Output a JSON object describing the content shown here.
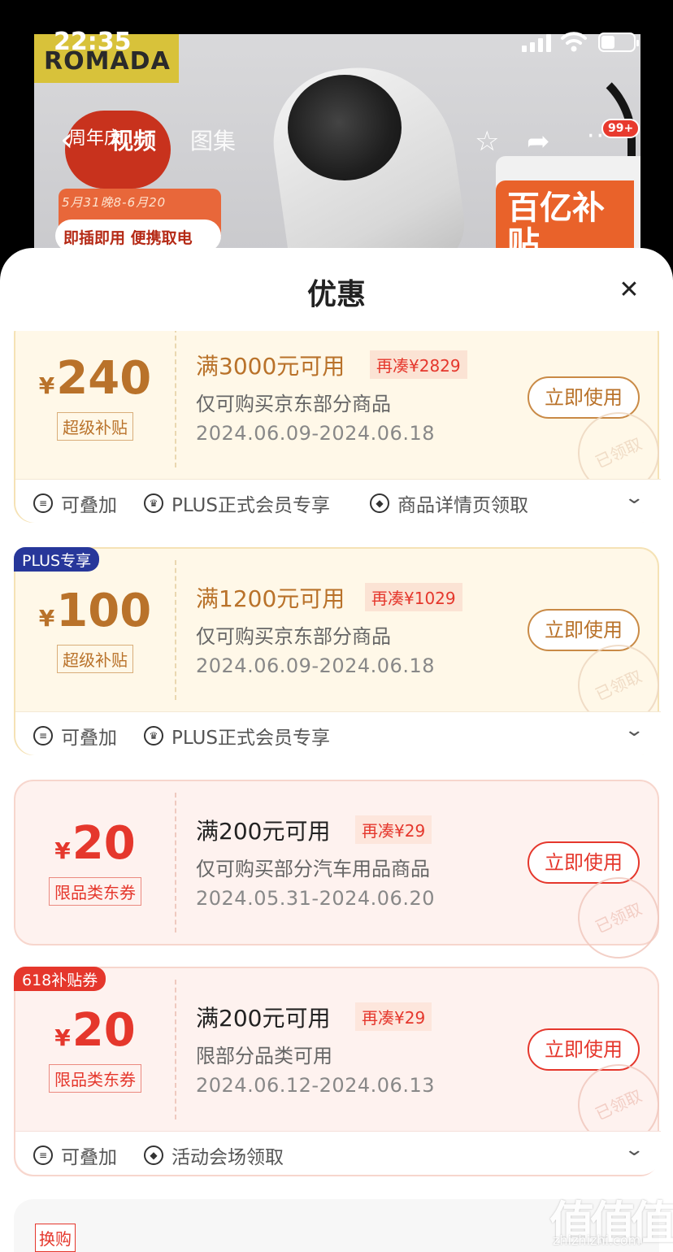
{
  "status_bar": {
    "time": "22:35"
  },
  "hero": {
    "brand": "ROMADA",
    "anniversary": "周年庆",
    "promo_dates": "5月31晚8-6月20",
    "promo_slogan": "即插即用 便携取电",
    "subsidy_badge": "百亿补贴",
    "tabs": [
      "视频",
      "图集"
    ],
    "cart_badge": "99+"
  },
  "sheet": {
    "title": "优惠"
  },
  "coupons": [
    {
      "corner_badge": "",
      "currency": "¥",
      "amount": "240",
      "tag": "超级补贴",
      "condition": "满3000元可用",
      "need": "再凑¥2829",
      "scope": "仅可购买京东部分商品",
      "dates": "2024.06.09-2024.06.18",
      "button": "立即使用",
      "stamp": "已领取",
      "footer": [
        "可叠加",
        "PLUS正式会员专享",
        "商品详情页领取"
      ]
    },
    {
      "corner_badge": "PLUS专享",
      "currency": "¥",
      "amount": "100",
      "tag": "超级补贴",
      "condition": "满1200元可用",
      "need": "再凑¥1029",
      "scope": "仅可购买京东部分商品",
      "dates": "2024.06.09-2024.06.18",
      "button": "立即使用",
      "stamp": "已领取",
      "footer": [
        "可叠加",
        "PLUS正式会员专享"
      ]
    },
    {
      "corner_badge": "",
      "currency": "¥",
      "amount": "20",
      "tag": "限品类东券",
      "condition": "满200元可用",
      "need": "再凑¥29",
      "scope": "仅可购买部分汽车用品商品",
      "dates": "2024.05.31-2024.06.20",
      "button": "立即使用",
      "stamp": "已领取",
      "footer": []
    },
    {
      "corner_badge": "618补贴券",
      "currency": "¥",
      "amount": "20",
      "tag": "限品类东券",
      "condition": "满200元可用",
      "need": "再凑¥29",
      "scope": "限部分品类可用",
      "dates": "2024.06.12-2024.06.13",
      "button": "立即使用",
      "stamp": "已领取",
      "footer": [
        "可叠加",
        "活动会场领取"
      ]
    }
  ],
  "next_card": {
    "tag": "换购"
  },
  "watermark": {
    "main": "值值值",
    "sub": "zhizhizhi.com"
  },
  "colors": {
    "plus_accent": "#b9722a",
    "red_accent": "#e5372c",
    "plus_badge": "#27379a"
  }
}
